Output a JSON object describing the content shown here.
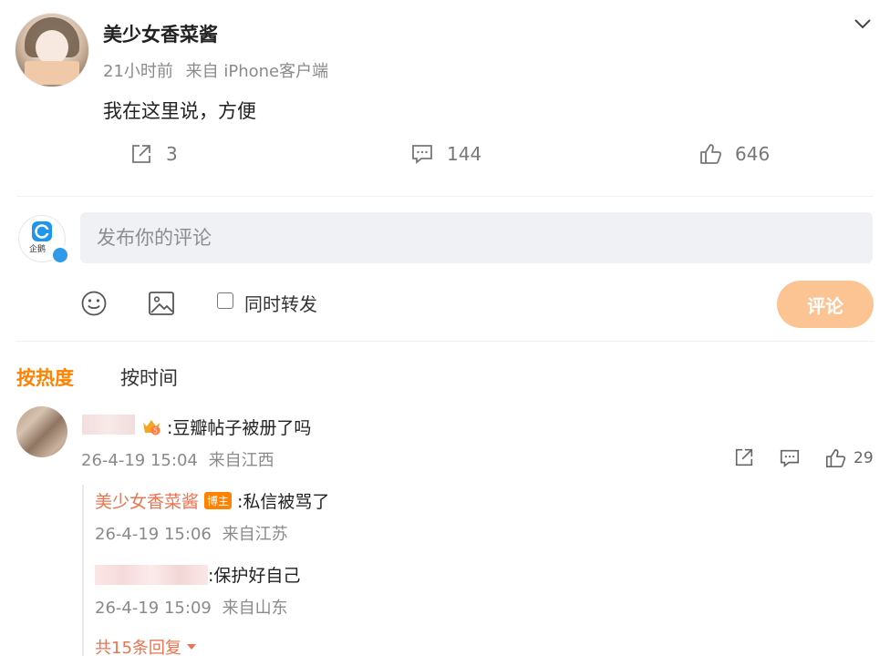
{
  "post": {
    "author": "美少女香菜酱",
    "time": "21小时前",
    "source": "来自 iPhone客户端",
    "content": "我在这里说，方便",
    "repost_count": "3",
    "comment_count": "144",
    "like_count": "646"
  },
  "composer": {
    "placeholder": "发布你的评论",
    "repost_label": "同时转发",
    "submit_label": "评论",
    "avatar_label": "企鹅"
  },
  "sort_tabs": {
    "hot": "按热度",
    "time": "按时间"
  },
  "comment": {
    "text": ":豆瓣帖子被册了吗",
    "time": "26-4-19 15:04",
    "location": "来自江西",
    "like_count": "29",
    "replies": [
      {
        "author": "美少女香菜酱",
        "badge": "博主",
        "text": ":私信被骂了",
        "time": "26-4-19 15:06",
        "location": "来自江苏"
      },
      {
        "text": ":保护好自己",
        "time": "26-4-19 15:09",
        "location": "来自山东"
      }
    ],
    "more_replies": "共15条回复"
  },
  "colors": {
    "accent": "#ff8200",
    "link": "#eb7350",
    "submit_bg": "#fcc493",
    "input_bg": "#f0f1f5"
  }
}
